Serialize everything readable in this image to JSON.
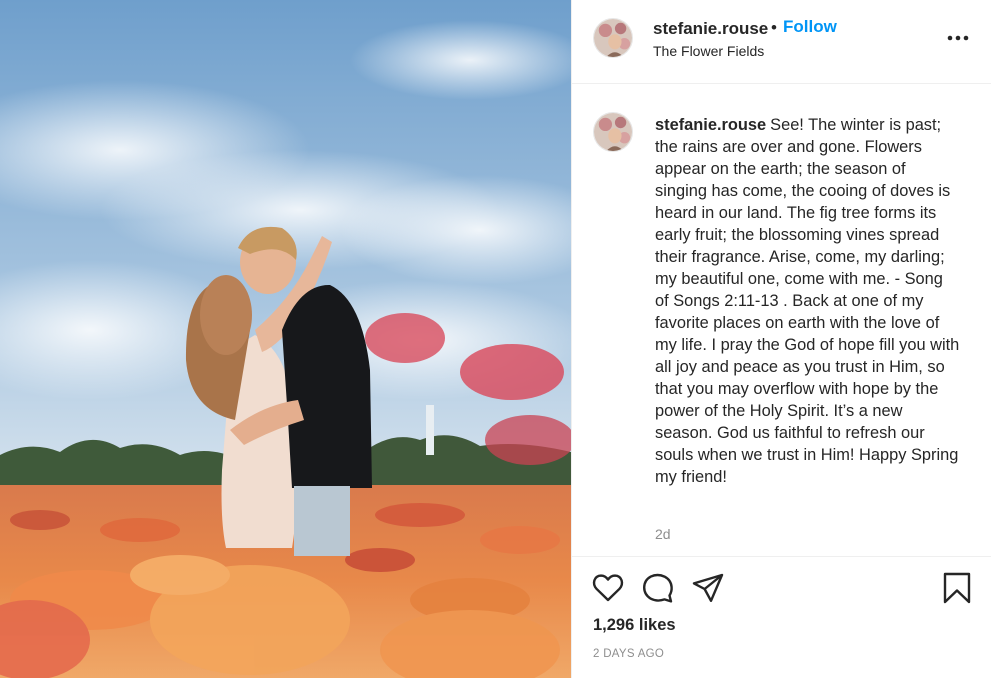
{
  "post": {
    "image": {
      "alt_icon": "photo-couple-in-flower-field"
    },
    "header": {
      "username": "stefanie.rouse",
      "separator": "•",
      "follow_label": "Follow",
      "location": "The Flower Fields",
      "more_icon": "more-options-icon"
    },
    "caption": {
      "username": "stefanie.rouse",
      "text": "See! The winter is past; the rains are over and gone. Flowers appear on the earth; the season of singing has come, the cooing of doves is heard in our land. The fig tree forms its early fruit; the blossoming vines spread their fragrance. Arise, come, my darling; my beautiful one, come with me. - Song of Songs 2:11-13 . Back at one of my favorite places on earth with the love of my life. I pray the God of hope fill you with all joy and peace as you trust in Him, so that you may overflow with hope by the power of the Holy Spirit. It’s a new season. God us faithful to refresh our souls when we trust in Him! Happy Spring my friend!",
      "time_ago": "2d"
    },
    "actions": {
      "like_icon": "heart-icon",
      "comment_icon": "comment-icon",
      "share_icon": "share-icon",
      "save_icon": "bookmark-icon"
    },
    "likes_label": "1,296 likes",
    "date_label": "2 DAYS AGO"
  },
  "colors": {
    "follow_accent": "#0095f6",
    "text_primary": "#262626",
    "text_secondary": "#8e8e8e",
    "divider": "#efefef"
  }
}
